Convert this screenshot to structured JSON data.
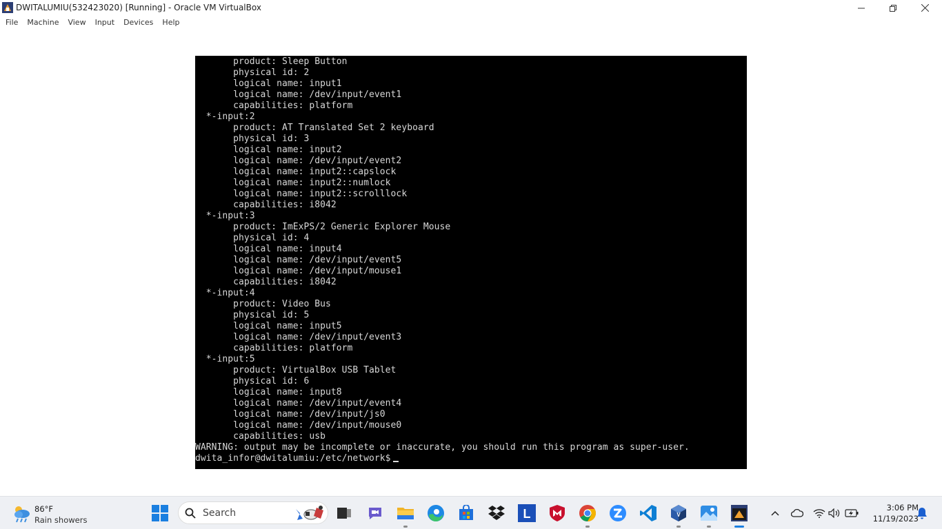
{
  "window": {
    "title": "DWITALUMIU(532423020) [Running] - Oracle VM VirtualBox"
  },
  "menu": [
    {
      "label": "File"
    },
    {
      "label": "Machine"
    },
    {
      "label": "View"
    },
    {
      "label": "Input"
    },
    {
      "label": "Devices"
    },
    {
      "label": "Help"
    }
  ],
  "terminal": {
    "lines": [
      "       product: Sleep Button",
      "       physical id: 2",
      "       logical name: input1",
      "       logical name: /dev/input/event1",
      "       capabilities: platform",
      "  *-input:2",
      "       product: AT Translated Set 2 keyboard",
      "       physical id: 3",
      "       logical name: input2",
      "       logical name: /dev/input/event2",
      "       logical name: input2::capslock",
      "       logical name: input2::numlock",
      "       logical name: input2::scrolllock",
      "       capabilities: i8042",
      "  *-input:3",
      "       product: ImExPS/2 Generic Explorer Mouse",
      "       physical id: 4",
      "       logical name: input4",
      "       logical name: /dev/input/event5",
      "       logical name: /dev/input/mouse1",
      "       capabilities: i8042",
      "  *-input:4",
      "       product: Video Bus",
      "       physical id: 5",
      "       logical name: input5",
      "       logical name: /dev/input/event3",
      "       capabilities: platform",
      "  *-input:5",
      "       product: VirtualBox USB Tablet",
      "       physical id: 6",
      "       logical name: input8",
      "       logical name: /dev/input/event4",
      "       logical name: /dev/input/js0",
      "       logical name: /dev/input/mouse0",
      "       capabilities: usb",
      "WARNING: output may be incomplete or inaccurate, you should run this program as super-user."
    ],
    "prompt": "dwita_infor@dwitalumiu:/etc/network$"
  },
  "taskbar": {
    "weather": {
      "temp": "86°F",
      "condition": "Rain showers",
      "icon": "rain-cloud-icon"
    },
    "search_label": "Search",
    "apps": [
      {
        "name": "start-button",
        "icon": "windows-logo-icon"
      },
      {
        "name": "task-view",
        "icon": "task-view-icon"
      },
      {
        "name": "teams-chat",
        "icon": "chat-icon"
      },
      {
        "name": "file-explorer",
        "icon": "folder-icon"
      },
      {
        "name": "edge",
        "icon": "edge-icon"
      },
      {
        "name": "store",
        "icon": "store-icon"
      },
      {
        "name": "dropbox",
        "icon": "dropbox-icon"
      },
      {
        "name": "l-app",
        "icon": "l-icon",
        "letter": "L"
      },
      {
        "name": "mcafee",
        "icon": "shield-m-icon"
      },
      {
        "name": "chrome",
        "icon": "chrome-icon"
      },
      {
        "name": "zoom",
        "icon": "zoom-icon"
      },
      {
        "name": "vscode",
        "icon": "vscode-icon"
      },
      {
        "name": "virtualbox",
        "icon": "virtualbox-icon"
      },
      {
        "name": "photos",
        "icon": "photos-icon"
      },
      {
        "name": "virtualbox-vm",
        "icon": "vm-window-icon"
      }
    ],
    "clock": {
      "time": "3:06 PM",
      "date": "11/19/2023"
    }
  },
  "colors": {
    "terminal_bg": "#000000",
    "terminal_fg": "#d8d8d8",
    "taskbar_bg": "#eef0f4"
  }
}
